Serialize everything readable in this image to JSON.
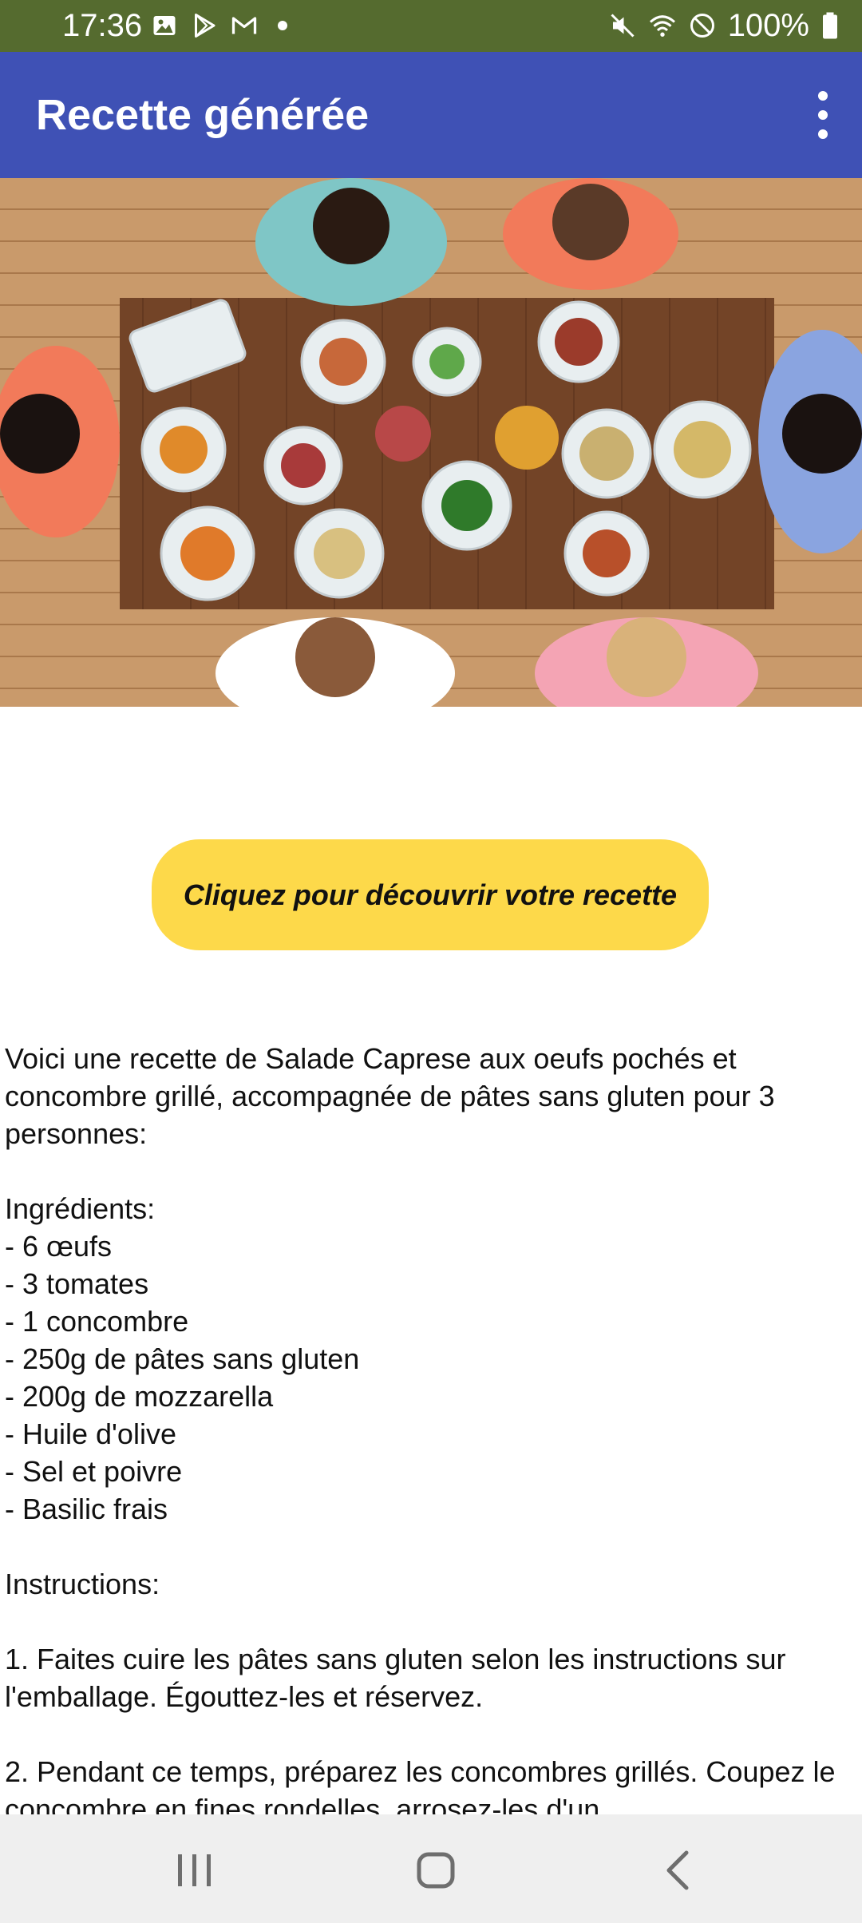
{
  "status": {
    "time": "17:36",
    "battery": "100%"
  },
  "app_bar": {
    "title": "Recette générée"
  },
  "hero_image": {
    "alt": "Table de repas vue du dessus"
  },
  "cta": {
    "label": "Cliquez pour découvrir votre recette"
  },
  "recipe": {
    "text": "Voici une recette de Salade Caprese aux oeufs pochés et concombre grillé, accompagnée de pâtes sans gluten pour 3 personnes:\n\nIngrédients:\n- 6 œufs\n- 3 tomates\n- 1 concombre\n- 250g de pâtes sans gluten\n- 200g de mozzarella\n- Huile d'olive\n- Sel et poivre\n- Basilic frais\n\nInstructions:\n\n1. Faites cuire les pâtes sans gluten selon les instructions sur l'emballage. Égouttez-les et réservez.\n\n2. Pendant ce temps, préparez les concombres grillés. Coupez le concombre en fines rondelles, arrosez-les d'un"
  },
  "colors": {
    "status_bar": "#556b2f",
    "app_bar": "#3f51b5",
    "cta_button": "#fdd94a",
    "nav_bar": "#efefef"
  },
  "icons": {
    "status_left": [
      "image-icon",
      "play-store-icon",
      "gmail-icon",
      "notification-dot-icon"
    ],
    "status_right": [
      "mute-icon",
      "wifi-icon",
      "do-not-disturb-icon",
      "battery-icon"
    ],
    "nav": [
      "recents-icon",
      "home-icon",
      "back-icon"
    ]
  }
}
